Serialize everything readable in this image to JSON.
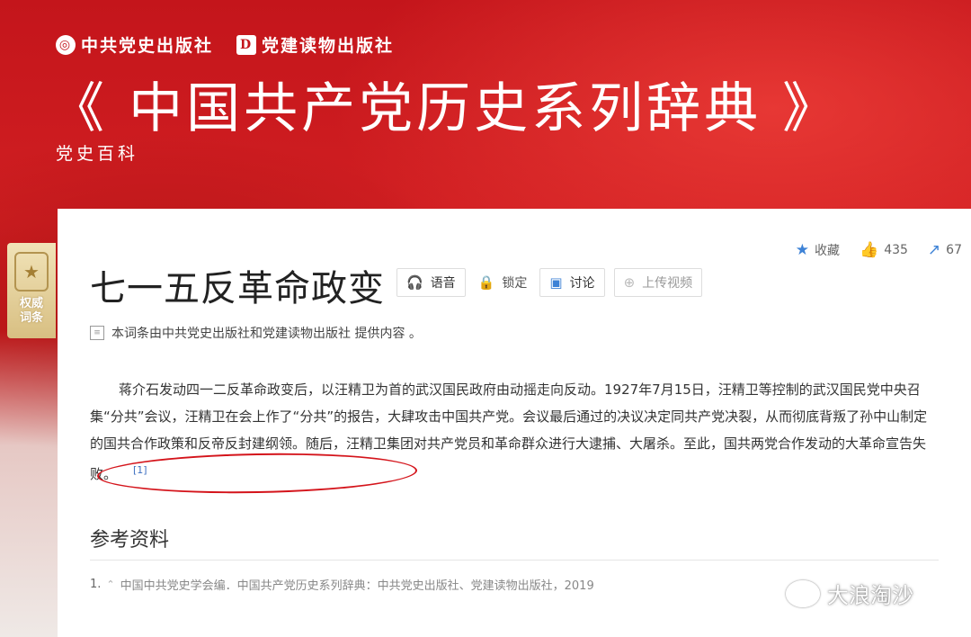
{
  "banner": {
    "publishers": [
      {
        "logo": "◎",
        "name": "中共党史出版社"
      },
      {
        "logo": "D",
        "name": "党建读物出版社"
      }
    ],
    "title": "《 中国共产党历史系列辞典 》",
    "subtitle": "党史百科"
  },
  "badge": {
    "icon": "medal-icon",
    "label": "权威词条"
  },
  "actions": {
    "favorite": {
      "icon": "star-icon",
      "label": "收藏"
    },
    "like": {
      "icon": "thumbs-up-icon",
      "count": "435"
    },
    "share": {
      "icon": "share-icon",
      "count": "67"
    }
  },
  "entry": {
    "title": "七一五反革命政变",
    "buttons": {
      "voice": "语音",
      "lock": "锁定",
      "discuss": "讨论",
      "upload_video": "上传视频"
    },
    "source": "本词条由中共党史出版社和党建读物出版社 提供内容 。",
    "paragraph": "蒋介石发动四一二反革命政变后，以汪精卫为首的武汉国民政府由动摇走向反动。1927年7月15日，汪精卫等控制的武汉国民党中央召集“分共”会议，汪精卫在会上作了“分共”的报告，大肆攻击中国共产党。会议最后通过的决议决定同共产党决裂，从而彻底背叛了孙中山制定的国共合作政策和反帝反封建纲领。随后，汪精卫集团对共产党员和革命群众进行大逮捕、大屠杀。至此，国共两党合作发动的大革命宣告失败。",
    "ref_marker": "[1]"
  },
  "references": {
    "title": "参考资料",
    "items": [
      {
        "num": "1.",
        "text": "中国中共党史学会编．中国共产党历史系列辞典：中共党史出版社、党建读物出版社，2019"
      }
    ]
  },
  "watermark": "大浪淘沙",
  "colors": {
    "accent": "#3d82d6",
    "banner_red": "#c4151b",
    "circle": "#d4141b"
  }
}
